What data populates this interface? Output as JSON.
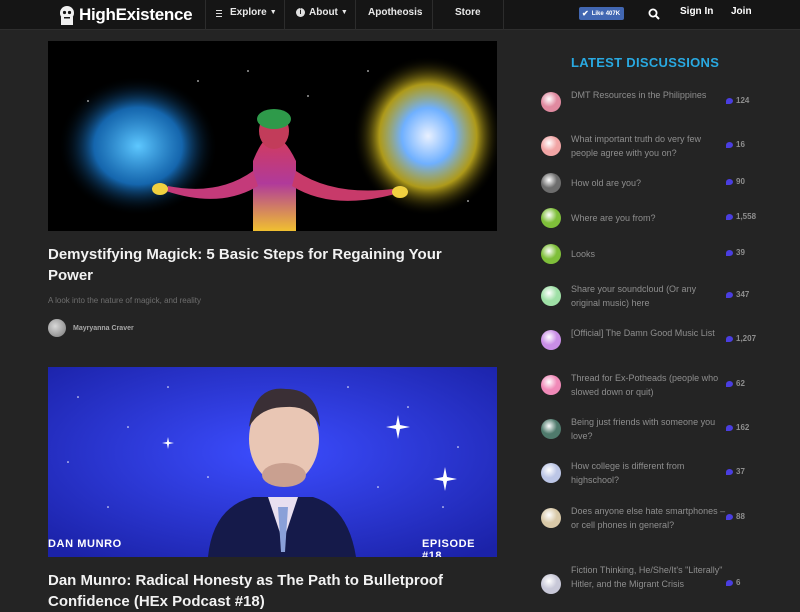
{
  "nav": {
    "logo": "HighExistence",
    "explore": "Explore",
    "about": "About",
    "apotheosis": "Apotheosis",
    "store": "Store",
    "fb_like": "Like",
    "fb_count": "407K",
    "signin": "Sign In",
    "join": "Join"
  },
  "articles": [
    {
      "title": "Demystifying Magick: 5 Basic Steps for Regaining Your Power",
      "subtitle": "A look into the nature of magick, and reality",
      "author": "Mayryanna Craver"
    },
    {
      "title": "Dan Munro: Radical Honesty as The Path to Bulletproof Confidence (HEx Podcast #18)",
      "overlay_left": "DAN MUNRO",
      "overlay_right": "EPISODE #18"
    }
  ],
  "sidebar": {
    "title": "LATEST DISCUSSIONS",
    "items": [
      {
        "text": "DMT Resources in the Philippines",
        "count": "124",
        "color": "#e08aa0"
      },
      {
        "text": "What important truth do very few people agree with you on?",
        "count": "16",
        "color": "#f1a5a5"
      },
      {
        "text": "How old are you?",
        "count": "90",
        "color": "#6d6d6d"
      },
      {
        "text": "Where are you from?",
        "count": "1,558",
        "color": "#7fbf3a"
      },
      {
        "text": "Looks",
        "count": "39",
        "color": "#7fbf3a"
      },
      {
        "text": "Share your soundcloud (Or any original music) here",
        "count": "347",
        "color": "#9fe0a6"
      },
      {
        "text": "[Official] The Damn Good Music List",
        "count": "1,207",
        "color": "#c98ee6"
      },
      {
        "text": "Thread for Ex-Potheads (people who slowed down or quit)",
        "count": "62",
        "color": "#f08ab8"
      },
      {
        "text": "Being just friends with someone you love?",
        "count": "162",
        "color": "#4f7a6c"
      },
      {
        "text": "How college is different from highschool?",
        "count": "37",
        "color": "#bcc6e6"
      },
      {
        "text": "Does anyone else hate smartphones – or cell phones in general?",
        "count": "88",
        "color": "#d9c9a8"
      },
      {
        "text": "Fiction Thinking, He/She/It's \"Literally\" Hitler, and the Migrant Crisis",
        "count": "6",
        "color": "#c8c8d8"
      }
    ]
  }
}
